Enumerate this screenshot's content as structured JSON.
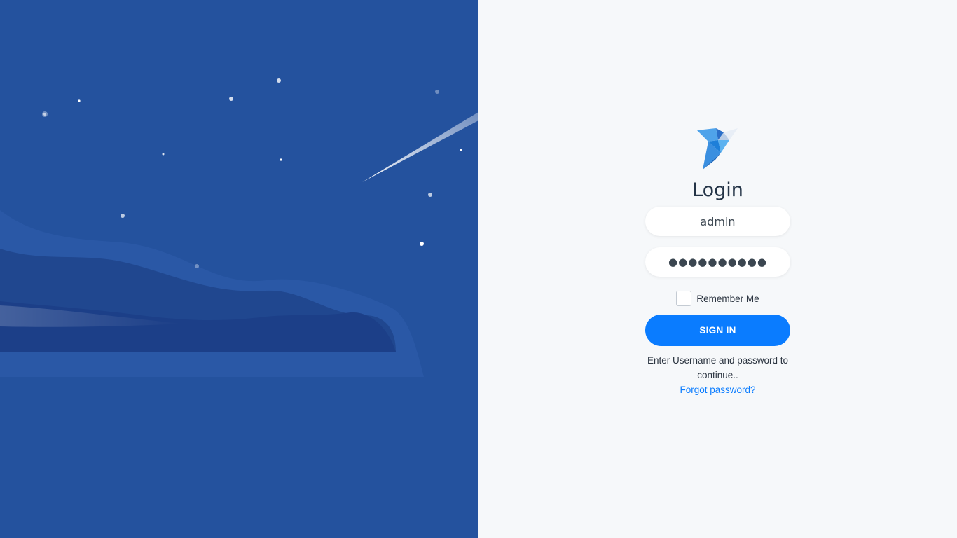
{
  "login": {
    "title": "Login",
    "username_value": "admin",
    "password_value": "●●●●●●●●●●",
    "remember_label": "Remember Me",
    "remember_checked": false,
    "signin_label": "SIGN IN",
    "help_text": "Enter Username and password to continue..",
    "forgot_label": "Forgot password?"
  },
  "colors": {
    "background_left": "#24529e",
    "background_right": "#f6f8fa",
    "accent": "#0a7cff",
    "text": "#2b3440"
  },
  "icons": {
    "logo": "origami-bird-icon"
  }
}
